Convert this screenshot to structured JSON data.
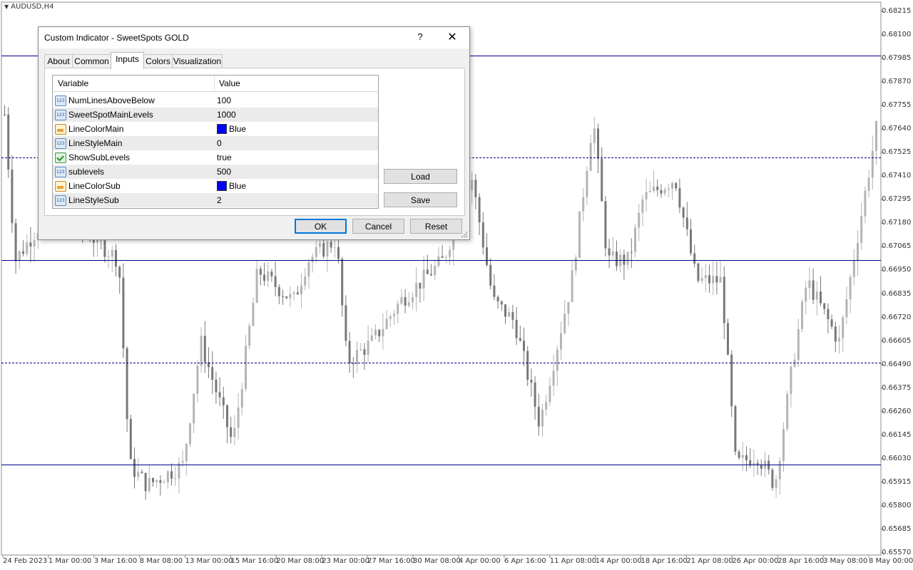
{
  "chart": {
    "symbol": "AUDUSD,H4",
    "price_labels": [
      "0.68215",
      "0.68100",
      "0.67985",
      "0.67870",
      "0.67755",
      "0.67640",
      "0.67525",
      "0.67410",
      "0.67295",
      "0.67180",
      "0.67065",
      "0.66950",
      "0.66835",
      "0.66720",
      "0.66605",
      "0.66490",
      "0.66375",
      "0.66260",
      "0.66145",
      "0.66030",
      "0.65915",
      "0.65800",
      "0.65685",
      "0.65570"
    ],
    "date_labels": [
      "24 Feb 2023",
      "1 Mar 00:00",
      "3 Mar 16:00",
      "8 Mar 08:00",
      "13 Mar 00:00",
      "15 Mar 16:00",
      "20 Mar 08:00",
      "23 Mar 00:00",
      "27 Mar 16:00",
      "30 Mar 08:00",
      "4 Apr 00:00",
      "6 Apr 16:00",
      "11 Apr 08:00",
      "14 Apr 00:00",
      "18 Apr 16:00",
      "21 Apr 08:00",
      "26 Apr 00:00",
      "28 Apr 16:00",
      "3 May 08:00",
      "8 May 00:00"
    ],
    "level_lines": [
      {
        "price": 0.68,
        "style": "solid"
      },
      {
        "price": 0.675,
        "style": "dashed"
      },
      {
        "price": 0.67,
        "style": "solid"
      },
      {
        "price": 0.665,
        "style": "dashed"
      },
      {
        "price": 0.66,
        "style": "solid"
      }
    ],
    "line_color": "#00008b",
    "candle_bull_color": "#b4b4b4",
    "candle_bear_color": "#787878"
  },
  "dialog": {
    "title": "Custom Indicator - SweetSpots GOLD",
    "help": "?",
    "close": "✕",
    "tabs": [
      "About",
      "Common",
      "Inputs",
      "Colors",
      "Visualization"
    ],
    "active_tab": "Inputs",
    "table": {
      "col_variable": "Variable",
      "col_value": "Value",
      "rows": [
        {
          "icon": "number-icon",
          "variable": "NumLinesAboveBelow",
          "value": "100"
        },
        {
          "icon": "number-icon",
          "variable": "SweetSpotMainLevels",
          "value": "1000"
        },
        {
          "icon": "color-icon",
          "variable": "LineColorMain",
          "value": "Blue",
          "swatch": "#0000ff"
        },
        {
          "icon": "number-icon",
          "variable": "LineStyleMain",
          "value": "0"
        },
        {
          "icon": "boolean-icon",
          "variable": "ShowSubLevels",
          "value": "true"
        },
        {
          "icon": "number-icon",
          "variable": "sublevels",
          "value": "500"
        },
        {
          "icon": "color-icon",
          "variable": "LineColorSub",
          "value": "Blue",
          "swatch": "#0000ff"
        },
        {
          "icon": "number-icon",
          "variable": "LineStyleSub",
          "value": "2"
        }
      ]
    },
    "buttons": {
      "load": "Load",
      "save": "Save",
      "ok": "OK",
      "cancel": "Cancel",
      "reset": "Reset"
    }
  }
}
